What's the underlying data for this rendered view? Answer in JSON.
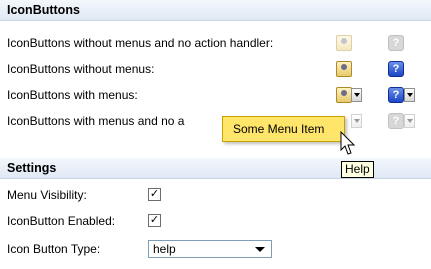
{
  "icon_buttons_section": {
    "title": "IconButtons",
    "rows": [
      {
        "label": "IconButtons without menus and no action handler:"
      },
      {
        "label": "IconButtons without menus:"
      },
      {
        "label": "IconButtons with menus:"
      },
      {
        "label": "IconButtons with menus and no a"
      }
    ]
  },
  "menu_popup": {
    "item_label": "Some Menu Item"
  },
  "tooltip": {
    "text": "Help"
  },
  "settings_section": {
    "title": "Settings",
    "menu_visibility": {
      "label": "Menu Visibility:",
      "checked": true,
      "mark": "✓"
    },
    "icon_button_enabled": {
      "label": "IconButton Enabled:",
      "checked": true,
      "mark": "✓"
    },
    "icon_button_type": {
      "label": "Icon Button Type:",
      "selected": "help"
    }
  },
  "icons": {
    "user": "user-icon",
    "help": "help-icon",
    "help_glyph": "?"
  }
}
